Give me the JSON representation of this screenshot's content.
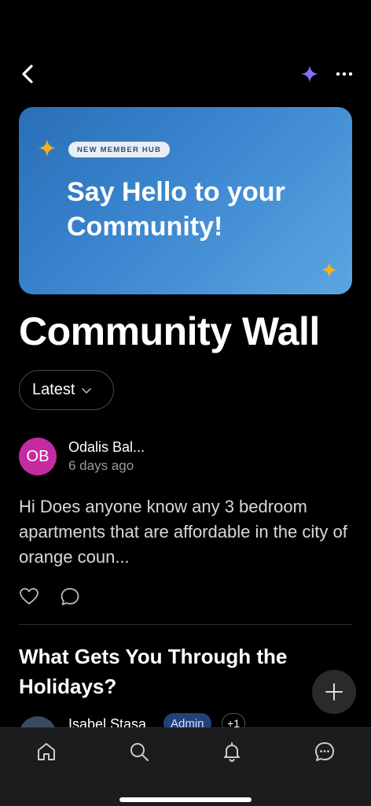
{
  "topbar": {
    "back": "back-icon",
    "sparkle": "sparkle-icon",
    "more": "more-icon"
  },
  "hero": {
    "pill": "NEW MEMBER HUB",
    "title": "Say Hello to your Community!"
  },
  "page": {
    "title": "Community Wall"
  },
  "sort": {
    "label": "Latest"
  },
  "post1": {
    "initials": "OB",
    "author": "Odalis Bal...",
    "time": "6 days ago",
    "body": "Hi Does anyone know any 3 bedroom apartments that are affordable in the city of orange coun..."
  },
  "post2": {
    "title": "What Gets You Through the Holidays?",
    "author": "Isabel Stasa",
    "badge": "Admin",
    "extra": "+1"
  },
  "colors": {
    "accent": "#8b6cf7",
    "star": "#f4b21b",
    "avatar": "#c52aa0",
    "hero": "#3b86cf"
  }
}
